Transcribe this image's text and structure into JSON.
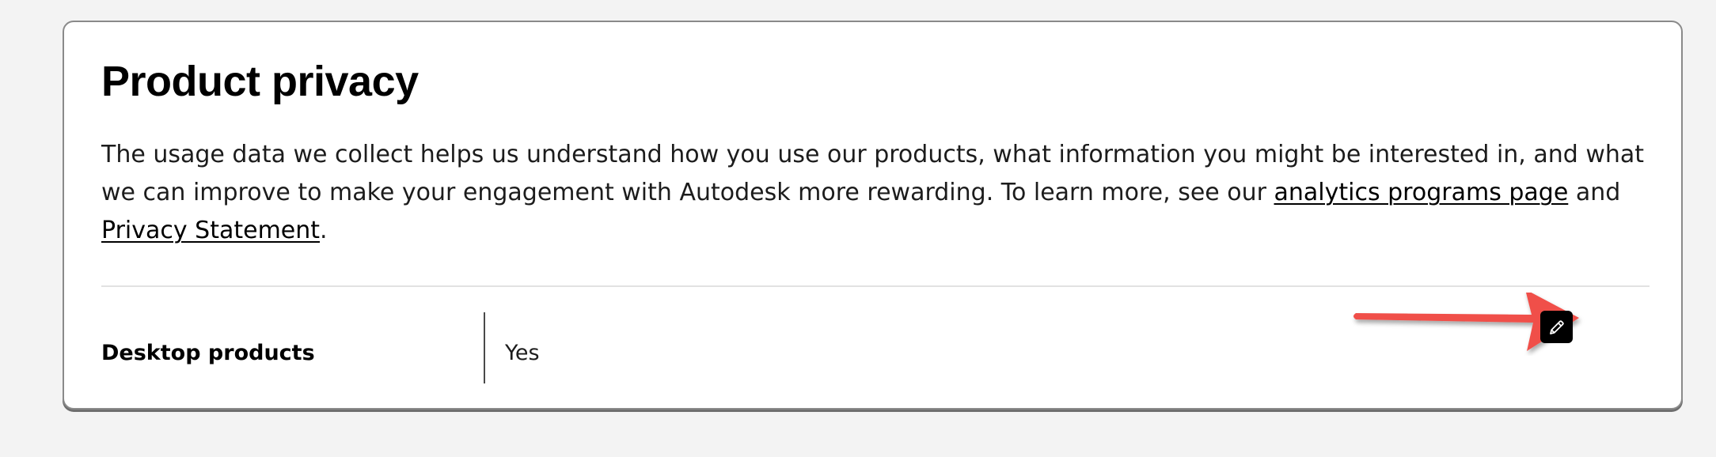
{
  "privacy_card": {
    "title": "Product privacy",
    "description_text_1": "The usage data we collect helps us understand how you use our products, what information you might be interested in, and what we can improve to make your engagement with Autodesk more rewarding. To learn more, see our ",
    "analytics_link_label": "analytics programs page",
    "description_text_2": " and ",
    "privacy_link_label": "Privacy Statement",
    "description_text_3": ".",
    "setting_row": {
      "label": "Desktop products",
      "value": "Yes",
      "edit_icon": "pencil-icon"
    },
    "annotation_arrow": {
      "icon": "arrow-right-icon",
      "color": "#f0504a"
    }
  }
}
